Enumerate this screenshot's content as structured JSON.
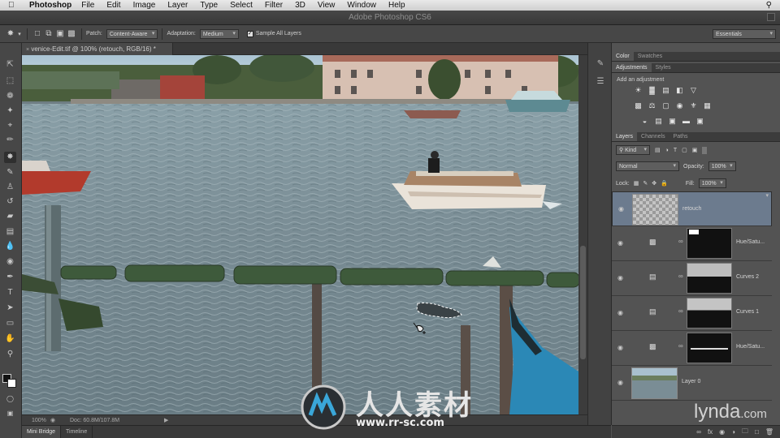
{
  "menubar": {
    "app_name": "Photoshop",
    "items": [
      "File",
      "Edit",
      "Image",
      "Layer",
      "Type",
      "Select",
      "Filter",
      "3D",
      "View",
      "Window",
      "Help"
    ]
  },
  "window": {
    "title": "Adobe Photoshop CS6"
  },
  "options": {
    "patch_label": "Patch:",
    "patch_value": "Content-Aware",
    "adaptation_label": "Adaptation:",
    "adaptation_value": "Medium",
    "sample_all_layers": "Sample All Layers",
    "sample_all_checked": true,
    "workspace": "Essentials"
  },
  "document": {
    "tab": "venice-Edit.tif @ 100% (retouch, RGB/16) *"
  },
  "status": {
    "zoom": "100%",
    "doc": "Doc: 60.8M/107.8M"
  },
  "bottom_tabs": [
    "Mini Bridge",
    "Timeline"
  ],
  "panels": {
    "color_tabs": [
      "Color",
      "Swatches"
    ],
    "adj_tabs": [
      "Adjustments",
      "Styles"
    ],
    "add_adjustment": "Add an adjustment",
    "layer_tabs": [
      "Layers",
      "Channels",
      "Paths"
    ],
    "kind": "Kind",
    "blend_mode": "Normal",
    "opacity_label": "Opacity:",
    "opacity": "100%",
    "lock_label": "Lock:",
    "fill_label": "Fill:",
    "fill": "100%"
  },
  "layers": [
    {
      "name": "retouch",
      "selected": true
    },
    {
      "name": "Hue/Satu..."
    },
    {
      "name": "Curves 2"
    },
    {
      "name": "Curves 1"
    },
    {
      "name": "Hue/Satu..."
    },
    {
      "name": "Layer 0"
    }
  ],
  "watermark": {
    "chinese": "人人素材",
    "url": "www.rr-sc.com",
    "brand": "lynda.com"
  },
  "colors": {
    "ui_dark": "#474747",
    "panel": "#535353",
    "selected_layer": "#6c7b8e"
  }
}
